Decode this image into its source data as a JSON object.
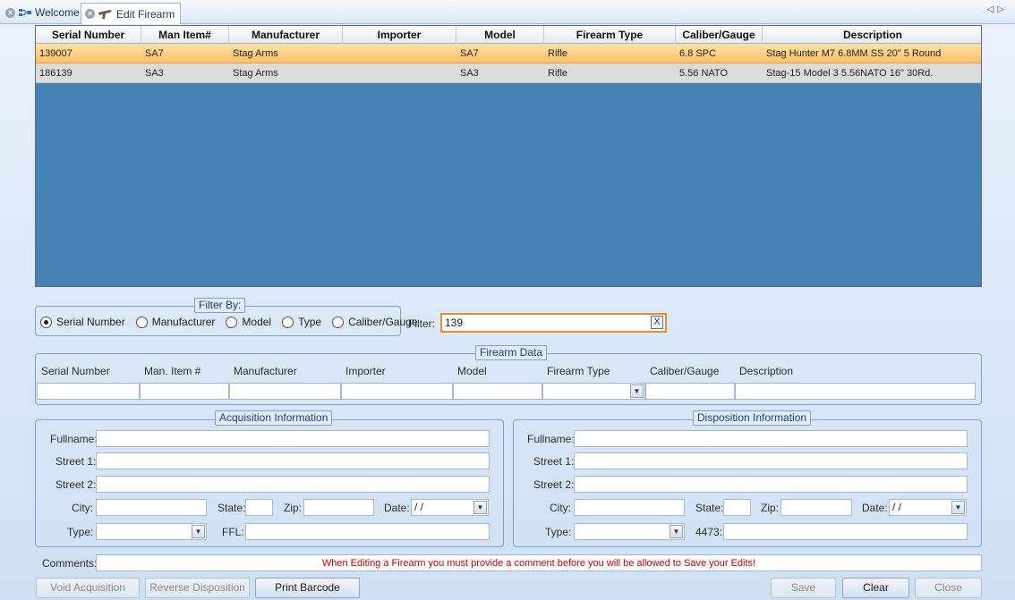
{
  "tabs": [
    {
      "label": "Welcome",
      "icon": "network-icon"
    },
    {
      "label": "Edit Firearm",
      "icon": "firearm-icon"
    }
  ],
  "grid": {
    "columns": [
      "Serial Number",
      "Man Item#",
      "Manufacturer",
      "Importer",
      "Model",
      "Firearm Type",
      "Caliber/Gauge",
      "Description"
    ],
    "rows": [
      [
        "139007",
        "SA7",
        "Stag Arms",
        "",
        "SA7",
        "Rifle",
        "6.8 SPC",
        "Stag Hunter M7 6.8MM SS 20\" 5 Round"
      ],
      [
        "186139",
        "SA3",
        "Stag Arms",
        "",
        "SA3",
        "Rifle",
        "5.56 NATO",
        "Stag-15 Model 3 5.56NATO 16\" 30Rd."
      ]
    ],
    "selected_row": 0
  },
  "filter_by": {
    "legend": "Filter By:",
    "options": [
      "Serial Number",
      "Manufacturer",
      "Model",
      "Type",
      "Caliber/Gauge"
    ],
    "selected": "Serial Number"
  },
  "filter": {
    "label": "Filter:",
    "value": "139",
    "clear_label": "X"
  },
  "firearm_data": {
    "legend": "Firearm Data",
    "labels": [
      "Serial Number",
      "Man. Item #",
      "Manufacturer",
      "Importer",
      "Model",
      "Firearm Type",
      "Caliber/Gauge",
      "Description"
    ],
    "values": [
      "",
      "",
      "",
      "",
      "",
      "",
      "",
      ""
    ]
  },
  "acquisition": {
    "legend": "Acquisition Information",
    "fullname_label": "Fullname:",
    "street1_label": "Street 1:",
    "street2_label": "Street 2:",
    "city_label": "City:",
    "state_label": "State:",
    "zip_label": "Zip:",
    "date_label": "Date:",
    "date_value": " /  /",
    "type_label": "Type:",
    "ffl_label": "FFL:"
  },
  "disposition": {
    "legend": "Disposition Information",
    "fullname_label": "Fullname:",
    "street1_label": "Street 1:",
    "street2_label": "Street 2:",
    "city_label": "City:",
    "state_label": "State:",
    "zip_label": "Zip:",
    "date_label": "Date:",
    "date_value": " /  /",
    "type_label": "Type:",
    "form4473_label": "4473:"
  },
  "comments": {
    "label": "Comments:",
    "message": "When Editing a Firearm you must provide a comment before you will be allowed to Save your Edits!",
    "message_color": "#c00000"
  },
  "buttons": {
    "void_acquisition": "Void Acquisition",
    "reverse_disposition": "Reverse Disposition",
    "print_barcode": "Print Barcode",
    "save": "Save",
    "clear": "Clear",
    "close": "Close"
  },
  "colors": {
    "grid_background": "#4682b4",
    "selected_row": "#fbc26a",
    "filter_border": "#e8902a"
  }
}
